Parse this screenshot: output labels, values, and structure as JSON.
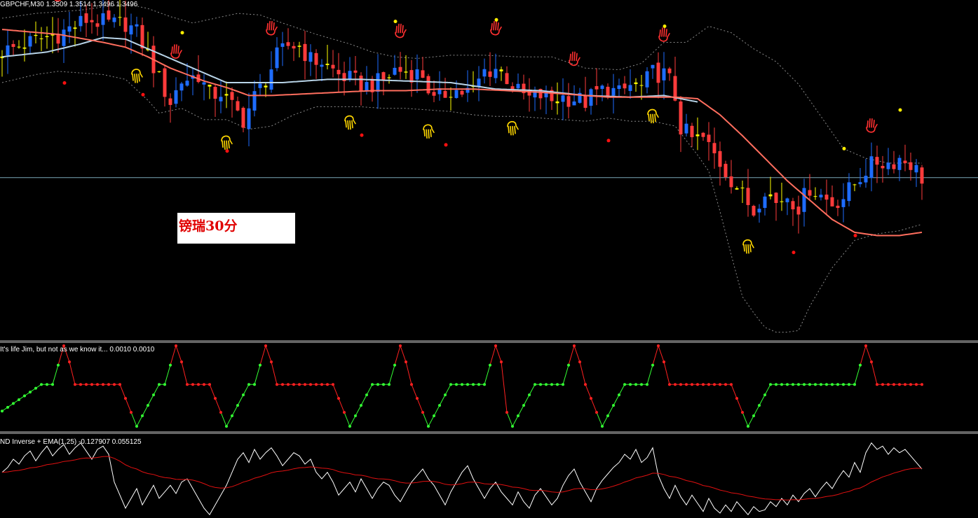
{
  "colors": {
    "background": "#000000",
    "bull_candle": "#1e6cff",
    "bear_candle": "#ff3b3b",
    "doji_candle": "#ffff00",
    "bands": "#8a8a8a",
    "slow_ma": "#ff6e5e",
    "fast_ma": "#b8d4e8",
    "level_line": "#7aa8b8",
    "fractal_up": "#ff3030",
    "fractal_down": "#ffd700",
    "dot_high": "#ffee00",
    "dot_low": "#ff1010",
    "ind1_up": "#33ff33",
    "ind1_down": "#ff2020",
    "ind2_line": "#ffffff",
    "ind2_ema": "#e01010"
  },
  "icons": {
    "fractal_up": "hand-icon",
    "fractal_down": "hand-icon"
  },
  "main_panel": {
    "title": "GBPCHF,M30  1.3509 1.3514 1.3496 1.3496",
    "watermark": "镑瑞30分"
  },
  "indicator1": {
    "title": "It's life Jim, but not as we know it...  0.0010 0.0010"
  },
  "indicator2": {
    "title": "ND Inverse + EMA(1,25) -0.127907 0.055125"
  },
  "chart_data": [
    {
      "type": "candlestick",
      "title": "GBPCHF,M30  1.3509 1.3514 1.3496 1.3496",
      "ylim": [
        1.3395,
        1.3605
      ],
      "level_line": 1.3496,
      "anchors": [
        [
          0,
          1.3574
        ],
        [
          5,
          1.358
        ],
        [
          10,
          1.3585
        ],
        [
          15,
          1.3594
        ],
        [
          20,
          1.3591
        ],
        [
          22,
          1.3592
        ],
        [
          24,
          1.3586
        ],
        [
          26,
          1.3573
        ],
        [
          28,
          1.3557
        ],
        [
          30,
          1.3543
        ],
        [
          32,
          1.3556
        ],
        [
          35,
          1.356
        ],
        [
          37,
          1.3547
        ],
        [
          39,
          1.3549
        ],
        [
          41,
          1.354
        ],
        [
          43,
          1.3532
        ],
        [
          45,
          1.3546
        ],
        [
          47,
          1.3557
        ],
        [
          49,
          1.3571
        ],
        [
          51,
          1.3578
        ],
        [
          53,
          1.3578
        ],
        [
          55,
          1.3569
        ],
        [
          57,
          1.3568
        ],
        [
          60,
          1.356
        ],
        [
          62,
          1.3557
        ],
        [
          65,
          1.3553
        ],
        [
          68,
          1.3556
        ],
        [
          70,
          1.3563
        ],
        [
          73,
          1.3561
        ],
        [
          75,
          1.356
        ],
        [
          77,
          1.3543
        ],
        [
          80,
          1.3551
        ],
        [
          82,
          1.3549
        ],
        [
          84,
          1.355
        ],
        [
          86,
          1.3562
        ],
        [
          88,
          1.3564
        ],
        [
          90,
          1.3558
        ],
        [
          92,
          1.3549
        ],
        [
          94,
          1.3545
        ],
        [
          96,
          1.3547
        ],
        [
          98,
          1.3544
        ],
        [
          100,
          1.3546
        ],
        [
          102,
          1.3545
        ],
        [
          104,
          1.3543
        ],
        [
          106,
          1.3549
        ],
        [
          108,
          1.3551
        ],
        [
          110,
          1.3548
        ],
        [
          112,
          1.3553
        ],
        [
          114,
          1.3552
        ],
        [
          116,
          1.3561
        ],
        [
          118,
          1.356
        ],
        [
          119,
          1.3556
        ],
        [
          120,
          1.3546
        ],
        [
          121,
          1.3527
        ],
        [
          123,
          1.352
        ],
        [
          125,
          1.352
        ],
        [
          127,
          1.351
        ],
        [
          129,
          1.35
        ],
        [
          131,
          1.349
        ],
        [
          133,
          1.348
        ],
        [
          134,
          1.3475
        ],
        [
          136,
          1.349
        ],
        [
          138,
          1.348
        ],
        [
          140,
          1.3485
        ],
        [
          142,
          1.3478
        ],
        [
          144,
          1.349
        ],
        [
          146,
          1.3485
        ],
        [
          148,
          1.348
        ],
        [
          150,
          1.3484
        ],
        [
          152,
          1.3492
        ],
        [
          154,
          1.3501
        ],
        [
          156,
          1.3506
        ],
        [
          158,
          1.3505
        ],
        [
          160,
          1.3508
        ],
        [
          162,
          1.3505
        ],
        [
          164,
          1.3496
        ]
      ],
      "slow_ma": [
        [
          0,
          1.3588
        ],
        [
          10,
          1.3585
        ],
        [
          18,
          1.358
        ],
        [
          22,
          1.3577
        ],
        [
          26,
          1.3571
        ],
        [
          30,
          1.3564
        ],
        [
          36,
          1.3556
        ],
        [
          40,
          1.3552
        ],
        [
          44,
          1.3547
        ],
        [
          48,
          1.3547
        ],
        [
          54,
          1.3548
        ],
        [
          60,
          1.3549
        ],
        [
          66,
          1.355
        ],
        [
          72,
          1.355
        ],
        [
          78,
          1.3551
        ],
        [
          84,
          1.3551
        ],
        [
          90,
          1.355
        ],
        [
          96,
          1.3549
        ],
        [
          100,
          1.3548
        ],
        [
          104,
          1.3547
        ],
        [
          108,
          1.3546
        ],
        [
          112,
          1.3546
        ],
        [
          116,
          1.3546
        ],
        [
          120,
          1.3546
        ],
        [
          124,
          1.3545
        ],
        [
          128,
          1.3535
        ],
        [
          132,
          1.3522
        ],
        [
          136,
          1.3508
        ],
        [
          140,
          1.3494
        ],
        [
          144,
          1.3482
        ],
        [
          148,
          1.347
        ],
        [
          152,
          1.3462
        ],
        [
          156,
          1.346
        ],
        [
          160,
          1.346
        ],
        [
          164,
          1.3462
        ]
      ],
      "fast_ma": [
        [
          0,
          1.3571
        ],
        [
          8,
          1.3574
        ],
        [
          14,
          1.3579
        ],
        [
          18,
          1.3583
        ],
        [
          22,
          1.3582
        ],
        [
          40,
          1.3555
        ],
        [
          50,
          1.3555
        ],
        [
          58,
          1.3557
        ],
        [
          64,
          1.3557
        ],
        [
          72,
          1.3556
        ],
        [
          80,
          1.3555
        ],
        [
          88,
          1.3551
        ],
        [
          96,
          1.355
        ],
        [
          104,
          1.3547
        ],
        [
          112,
          1.3546
        ],
        [
          118,
          1.3547
        ],
        [
          124,
          1.3543
        ]
      ],
      "band_upper": [
        [
          0,
          1.3595
        ],
        [
          6,
          1.3598
        ],
        [
          10,
          1.3599
        ],
        [
          14,
          1.36
        ],
        [
          18,
          1.3602
        ],
        [
          22,
          1.3604
        ],
        [
          26,
          1.3601
        ],
        [
          30,
          1.3596
        ],
        [
          34,
          1.3592
        ],
        [
          38,
          1.3595
        ],
        [
          42,
          1.3598
        ],
        [
          46,
          1.3597
        ],
        [
          50,
          1.3592
        ],
        [
          56,
          1.3585
        ],
        [
          62,
          1.3579
        ],
        [
          66,
          1.3574
        ],
        [
          70,
          1.3571
        ],
        [
          74,
          1.357
        ],
        [
          80,
          1.3572
        ],
        [
          86,
          1.3572
        ],
        [
          92,
          1.3571
        ],
        [
          98,
          1.3571
        ],
        [
          104,
          1.3564
        ],
        [
          110,
          1.3563
        ],
        [
          114,
          1.3567
        ],
        [
          118,
          1.358
        ],
        [
          122,
          1.358
        ],
        [
          126,
          1.359
        ],
        [
          130,
          1.3586
        ],
        [
          134,
          1.3576
        ],
        [
          138,
          1.3568
        ],
        [
          142,
          1.3554
        ],
        [
          146,
          1.3534
        ],
        [
          150,
          1.3514
        ],
        [
          154,
          1.3508
        ],
        [
          158,
          1.3505
        ],
        [
          162,
          1.3505
        ],
        [
          164,
          1.3505
        ]
      ],
      "band_lower": [
        [
          0,
          1.3555
        ],
        [
          6,
          1.356
        ],
        [
          10,
          1.3562
        ],
        [
          14,
          1.3561
        ],
        [
          18,
          1.356
        ],
        [
          22,
          1.3557
        ],
        [
          26,
          1.3544
        ],
        [
          28,
          1.3536
        ],
        [
          32,
          1.3539
        ],
        [
          36,
          1.3532
        ],
        [
          40,
          1.3532
        ],
        [
          44,
          1.3526
        ],
        [
          48,
          1.3528
        ],
        [
          52,
          1.3535
        ],
        [
          56,
          1.354
        ],
        [
          60,
          1.354
        ],
        [
          64,
          1.354
        ],
        [
          68,
          1.3539
        ],
        [
          72,
          1.3539
        ],
        [
          76,
          1.3538
        ],
        [
          80,
          1.3537
        ],
        [
          84,
          1.3535
        ],
        [
          88,
          1.3534
        ],
        [
          92,
          1.3534
        ],
        [
          96,
          1.3533
        ],
        [
          100,
          1.3532
        ],
        [
          104,
          1.3531
        ],
        [
          108,
          1.3533
        ],
        [
          112,
          1.3531
        ],
        [
          116,
          1.3531
        ],
        [
          120,
          1.3528
        ],
        [
          124,
          1.351
        ],
        [
          126,
          1.35
        ],
        [
          128,
          1.3475
        ],
        [
          130,
          1.3448
        ],
        [
          132,
          1.3422
        ],
        [
          134,
          1.3412
        ],
        [
          136,
          1.3403
        ],
        [
          138,
          1.34
        ],
        [
          140,
          1.34
        ],
        [
          142,
          1.3401
        ],
        [
          144,
          1.3416
        ],
        [
          148,
          1.344
        ],
        [
          152,
          1.3457
        ],
        [
          156,
          1.3461
        ],
        [
          160,
          1.3463
        ],
        [
          164,
          1.3467
        ]
      ],
      "fractals_up": [
        10,
        31,
        48,
        71,
        88,
        102,
        118,
        155
      ],
      "fractals_down": [
        24,
        40,
        62,
        76,
        91,
        116,
        133
      ],
      "dots_high": [
        10,
        17,
        32,
        51,
        70,
        88,
        118,
        150,
        160
      ],
      "dots_low": [
        11,
        25,
        40,
        64,
        79,
        108,
        141,
        152
      ]
    },
    {
      "type": "line",
      "title": "It's life Jim, but not as we know it...  0.0010 0.0010",
      "ylim": [
        0,
        1
      ],
      "cycles": [
        {
          "start": 0,
          "bottom": -4,
          "rise": 7,
          "peak": 11
        },
        {
          "start": 11,
          "bottom": 24,
          "rise": 28,
          "peak": 31
        },
        {
          "start": 31,
          "bottom": 40,
          "rise": 44,
          "peak": 47
        },
        {
          "start": 47,
          "bottom": 62,
          "rise": 66,
          "peak": 71
        },
        {
          "start": 71,
          "bottom": 76,
          "rise": 80,
          "peak": 88
        },
        {
          "start": 88,
          "bottom": 91,
          "rise": 95,
          "peak": 102
        },
        {
          "start": 102,
          "bottom": 107,
          "rise": 111,
          "peak": 117
        },
        {
          "start": 117,
          "bottom": 133,
          "rise": 137,
          "peak": 154
        },
        {
          "start": 154,
          "bottom": 171,
          "rise": 175,
          "peak": 178
        }
      ],
      "end": 164
    },
    {
      "type": "line",
      "title": "ND Inverse + EMA(1,25) -0.127907 0.055125",
      "ylim": [
        -1.2,
        1.2
      ],
      "series_line": [
        0.2,
        0.35,
        0.6,
        0.45,
        0.7,
        0.85,
        0.55,
        0.8,
        1.0,
        0.7,
        0.9,
        1.05,
        0.75,
        0.95,
        1.1,
        0.85,
        0.6,
        0.9,
        1.0,
        0.75,
        -0.1,
        -0.5,
        -0.9,
        -0.6,
        -0.3,
        -0.8,
        -0.5,
        -0.2,
        -0.6,
        -0.4,
        -0.2,
        -0.45,
        -0.1,
        0.0,
        -0.3,
        -0.6,
        -0.9,
        -1.1,
        -0.8,
        -0.5,
        -0.2,
        0.2,
        0.6,
        0.8,
        0.5,
        0.9,
        0.6,
        0.8,
        0.95,
        0.7,
        0.4,
        0.6,
        0.8,
        0.7,
        0.45,
        0.6,
        0.2,
        0.0,
        0.2,
        -0.1,
        -0.5,
        -0.3,
        -0.1,
        -0.4,
        0.0,
        -0.3,
        -0.6,
        -0.3,
        -0.1,
        -0.2,
        -0.5,
        -0.7,
        -0.4,
        -0.1,
        0.1,
        0.3,
        0.0,
        -0.2,
        -0.5,
        -0.8,
        -0.4,
        -0.1,
        0.2,
        0.4,
        0.0,
        -0.3,
        -0.6,
        -0.3,
        -0.1,
        -0.4,
        -0.6,
        -0.8,
        -0.4,
        -0.7,
        -0.9,
        -0.5,
        -0.3,
        -0.55,
        -0.8,
        -0.6,
        -0.2,
        0.1,
        0.3,
        -0.1,
        -0.4,
        -0.7,
        -0.3,
        -0.05,
        0.15,
        0.35,
        0.5,
        0.75,
        0.6,
        0.9,
        0.5,
        0.65,
        0.95,
        0.1,
        -0.3,
        -0.6,
        -0.2,
        -0.55,
        -0.8,
        -0.5,
        -0.75,
        -1.0,
        -0.6,
        -0.9,
        -1.05,
        -0.8,
        -1.0,
        -0.7,
        -0.9,
        -1.1,
        -0.85,
        -1.0,
        -0.95,
        -0.7,
        -0.85,
        -0.6,
        -0.8,
        -0.5,
        -0.7,
        -0.45,
        -0.3,
        -0.55,
        -0.3,
        -0.1,
        -0.3,
        0.0,
        0.25,
        0.05,
        0.5,
        0.2,
        0.8,
        1.1,
        0.9,
        1.0,
        0.75,
        0.95,
        0.8,
        0.9,
        0.7,
        0.5,
        0.3,
        -0.3
      ]
    }
  ]
}
